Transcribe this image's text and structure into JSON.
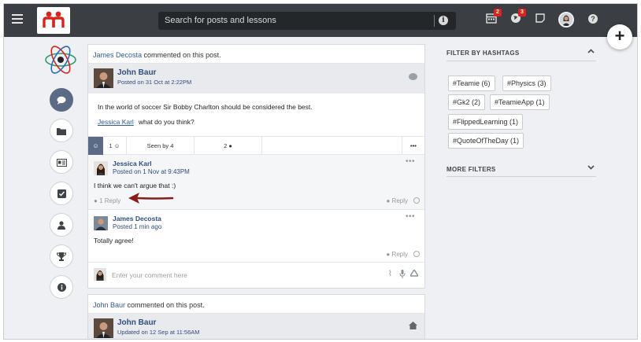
{
  "topbar": {
    "search_placeholder": "Search for posts and lessons",
    "calendar_badge": "2",
    "globe_badge": "3"
  },
  "feed": {
    "post1": {
      "activity_actor": "James Decosta",
      "activity_text": " commented on this post.",
      "author": "John Baur",
      "date": "Posted on 31 Oct at 2:22PM",
      "body": "In the world of soccer Sir Bobby Charlton should be considered the best.",
      "mention": "Jessica Karl",
      "mention_text": "what do you think?",
      "likes": "1",
      "seen": "Seen by 4",
      "comments": "2",
      "comments_list": [
        {
          "author": "Jessica Karl",
          "date": "Posted on 1 Nov at 9:43PM",
          "text": "I think we can't argue that :)",
          "replies": "1 Reply",
          "reply_label": "Reply"
        },
        {
          "author": "James Decosta",
          "date": "Posted 1 min ago",
          "text": "Totally agree!",
          "reply_label": "Reply"
        }
      ],
      "compose_placeholder": "Enter your comment here"
    },
    "post2": {
      "activity_actor": "John Baur",
      "activity_text": " commented on this post.",
      "author": "John Baur",
      "date": "Updated on 12 Sep at 11:56AM"
    }
  },
  "filters": {
    "title": "FILTER BY HASHTAGS",
    "hashtags": [
      "#Teamie (6)",
      "#Physics (3)",
      "#Gk2 (2)",
      "#TeamieApp (1)",
      "#FlippedLearning (1)",
      "#QuoteOfTheDay (1)"
    ],
    "more_title": "MORE FILTERS"
  },
  "colors": {
    "topbar": "#3b3e42",
    "accent": "#5b6a85",
    "badge": "#d9241b",
    "link": "#2f4d82",
    "annotation_arrow": "#8b1a1a"
  }
}
